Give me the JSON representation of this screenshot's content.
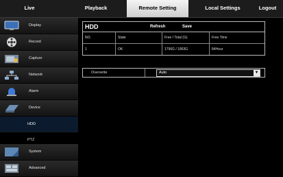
{
  "nav": {
    "tabs": [
      "Live",
      "Playback",
      "Remote Setting",
      "Local Settings",
      "Logout"
    ],
    "active": "Remote Setting"
  },
  "sidebar": {
    "items": [
      {
        "label": "Display",
        "icon": "monitor-icon"
      },
      {
        "label": "Record",
        "icon": "film-reel-icon"
      },
      {
        "label": "Capture",
        "icon": "camera-capture-icon"
      },
      {
        "label": "Network",
        "icon": "network-icon"
      },
      {
        "label": "Alarm",
        "icon": "alarm-siren-icon"
      },
      {
        "label": "Device",
        "icon": "device-icon"
      },
      {
        "label": "System",
        "icon": "system-icon"
      },
      {
        "label": "Advanced",
        "icon": "advanced-icon"
      }
    ],
    "device_sub": [
      "HDD",
      "PTZ"
    ],
    "active_sub": "HDD"
  },
  "hdd": {
    "title": "HDD",
    "refresh_label": "Refresh",
    "save_label": "Save",
    "columns": [
      "NO.",
      "State",
      "Free / Total (G)",
      "Free Time"
    ],
    "rows": [
      [
        "1",
        "OK",
        "1796G / 1863G",
        "84Hour"
      ]
    ]
  },
  "overwrite": {
    "label": "Overwrite",
    "value": "Auto"
  },
  "colors": {
    "active_tab_bg": "#e0e0e0",
    "active_sub_bg": "#0c1a2e",
    "panel_border": "#bbbbbb"
  }
}
